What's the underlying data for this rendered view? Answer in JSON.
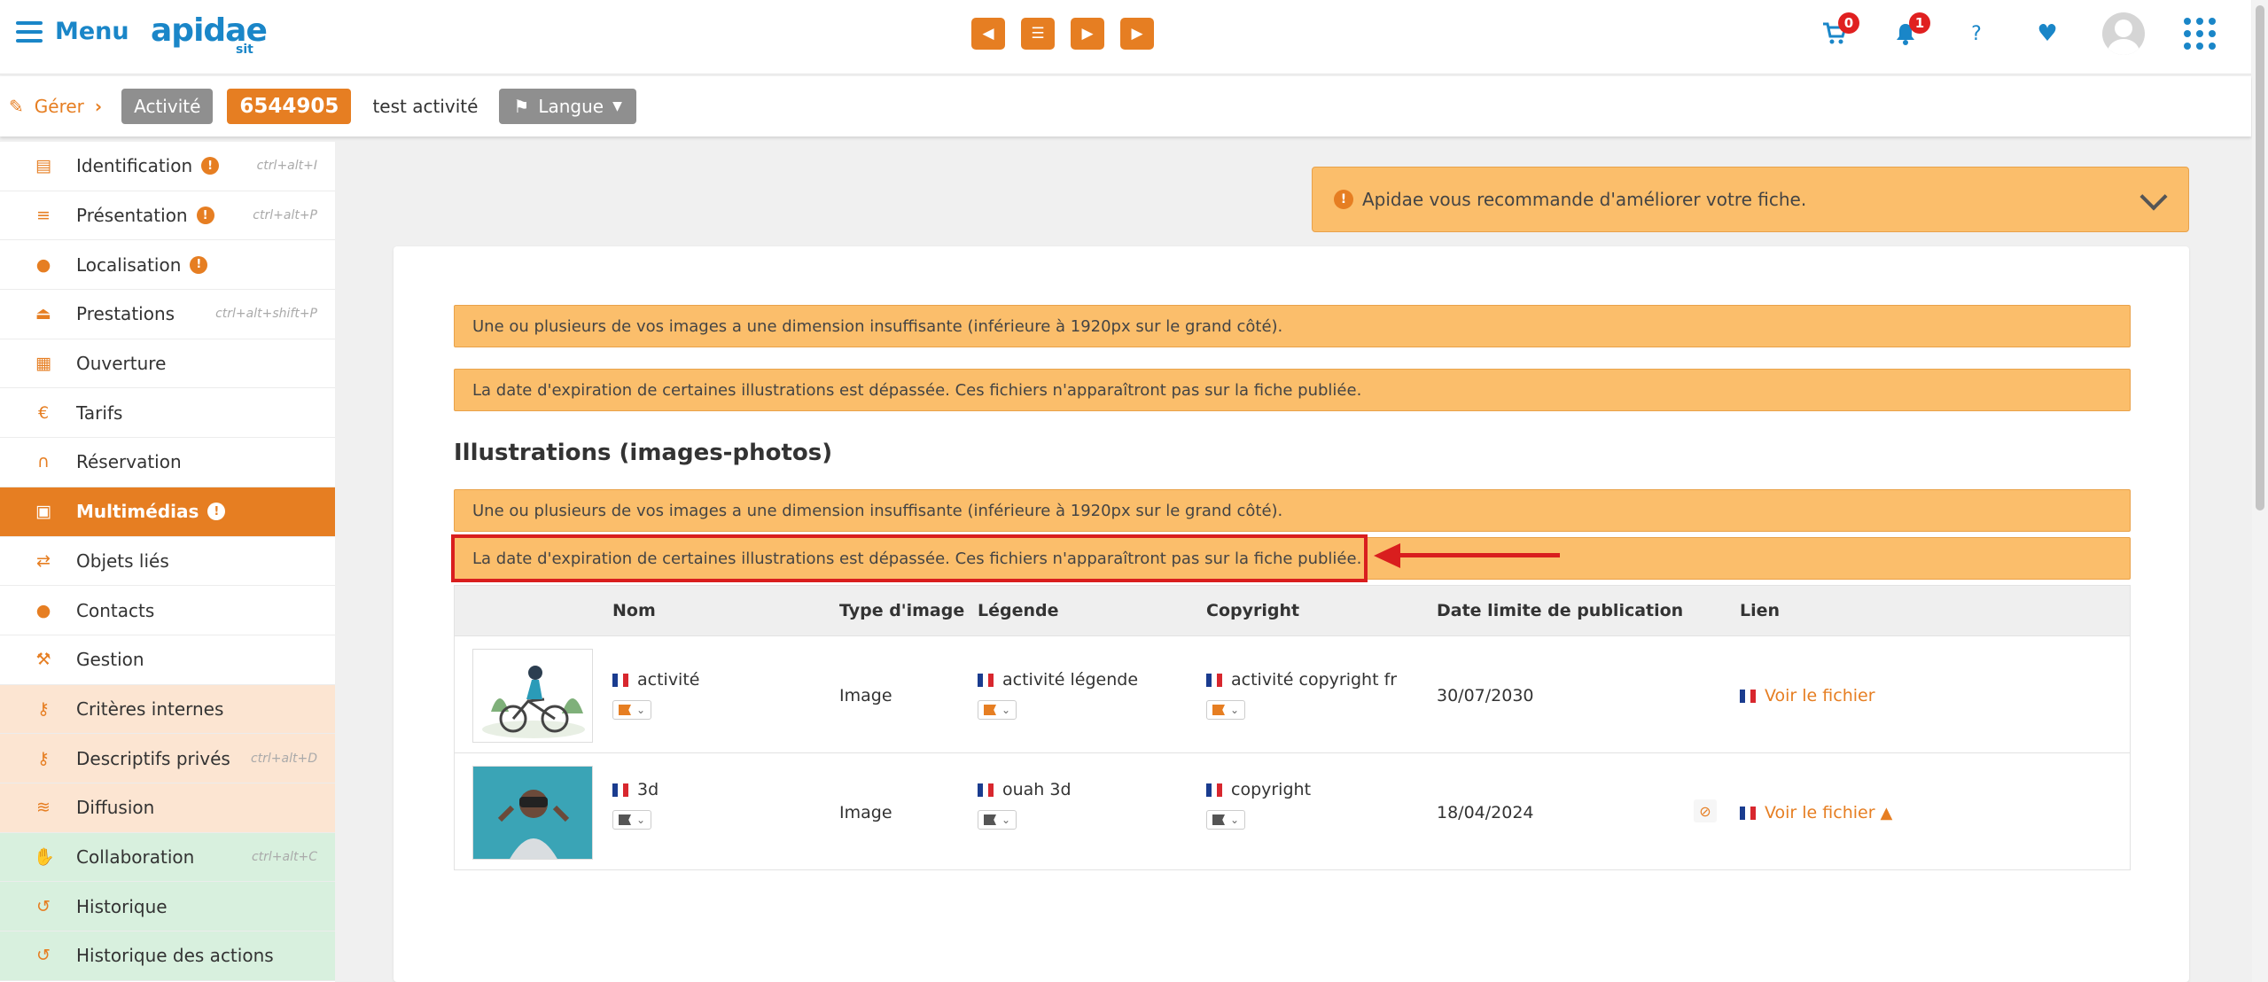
{
  "header": {
    "menu_label": "Menu",
    "logo_text": "apidae",
    "logo_sub": "sit",
    "cart_count": "0",
    "notif_count": "1",
    "help_label": "?"
  },
  "subbar": {
    "gerer": "Gérer",
    "type_tag": "Activité",
    "id_tag": "6544905",
    "title": "test activité",
    "langue": "Langue"
  },
  "sidebar": {
    "items": [
      {
        "label": "Identification",
        "kbd": "ctrl+alt+I",
        "icon": "id-card-icon"
      },
      {
        "label": "Présentation",
        "kbd": "ctrl+alt+P",
        "icon": "list-icon"
      },
      {
        "label": "Localisation",
        "kbd": "",
        "icon": "map-pin-icon"
      },
      {
        "label": "Prestations",
        "kbd": "ctrl+alt+shift+P",
        "icon": "service-bell-icon"
      },
      {
        "label": "Ouverture",
        "kbd": "",
        "icon": "calendar-icon"
      },
      {
        "label": "Tarifs",
        "kbd": "",
        "icon": "euro-icon"
      },
      {
        "label": "Réservation",
        "kbd": "",
        "icon": "headset-icon"
      },
      {
        "label": "Multimédias",
        "kbd": "",
        "icon": "images-icon"
      },
      {
        "label": "Objets liés",
        "kbd": "",
        "icon": "exchange-icon"
      },
      {
        "label": "Contacts",
        "kbd": "",
        "icon": "users-icon"
      },
      {
        "label": "Gestion",
        "kbd": "",
        "icon": "wrench-icon"
      },
      {
        "label": "Critères internes",
        "kbd": "",
        "icon": "key-icon"
      },
      {
        "label": "Descriptifs privés",
        "kbd": "ctrl+alt+D",
        "icon": "key-icon"
      },
      {
        "label": "Diffusion",
        "kbd": "",
        "icon": "rss-icon"
      },
      {
        "label": "Collaboration",
        "kbd": "ctrl+alt+C",
        "icon": "handshake-icon"
      },
      {
        "label": "Historique",
        "kbd": "",
        "icon": "history-icon"
      },
      {
        "label": "Historique des actions",
        "kbd": "",
        "icon": "history-icon"
      }
    ],
    "warn_mark": "!"
  },
  "main": {
    "recommendation": "Apidae vous recommande d'améliorer votre fiche.",
    "alerts_top": [
      "Une ou plusieurs de vos images a une dimension insuffisante (inférieure à 1920px sur le grand côté).",
      "La date d'expiration de certaines illustrations est dépassée. Ces fichiers n'apparaîtront pas sur la fiche publiée."
    ],
    "section_title": "Illustrations (images-photos)",
    "alerts_section": [
      "Une ou plusieurs de vos images a une dimension insuffisante (inférieure à 1920px sur le grand côté).",
      "La date d'expiration de certaines illustrations est dépassée. Ces fichiers n'apparaîtront pas sur la fiche publiée."
    ],
    "table": {
      "headers": [
        "Nom",
        "Type d'image",
        "Légende",
        "Copyright",
        "Date limite de publication",
        "Lien"
      ],
      "rows": [
        {
          "nom": "activité",
          "type": "Image",
          "legende": "activité légende",
          "copyright": "activité copyright fr",
          "date": "30/07/2030",
          "lien": "Voir le fichier"
        },
        {
          "nom": "3d",
          "type": "Image",
          "legende": "ouah 3d",
          "copyright": "copyright",
          "date": "18/04/2024",
          "lien": "Voir le fichier"
        }
      ]
    }
  },
  "colors": {
    "accent": "#e67e22",
    "brand": "#1a86c8",
    "alert_bg": "#fbbe6b",
    "highlight": "#d91e1e"
  }
}
